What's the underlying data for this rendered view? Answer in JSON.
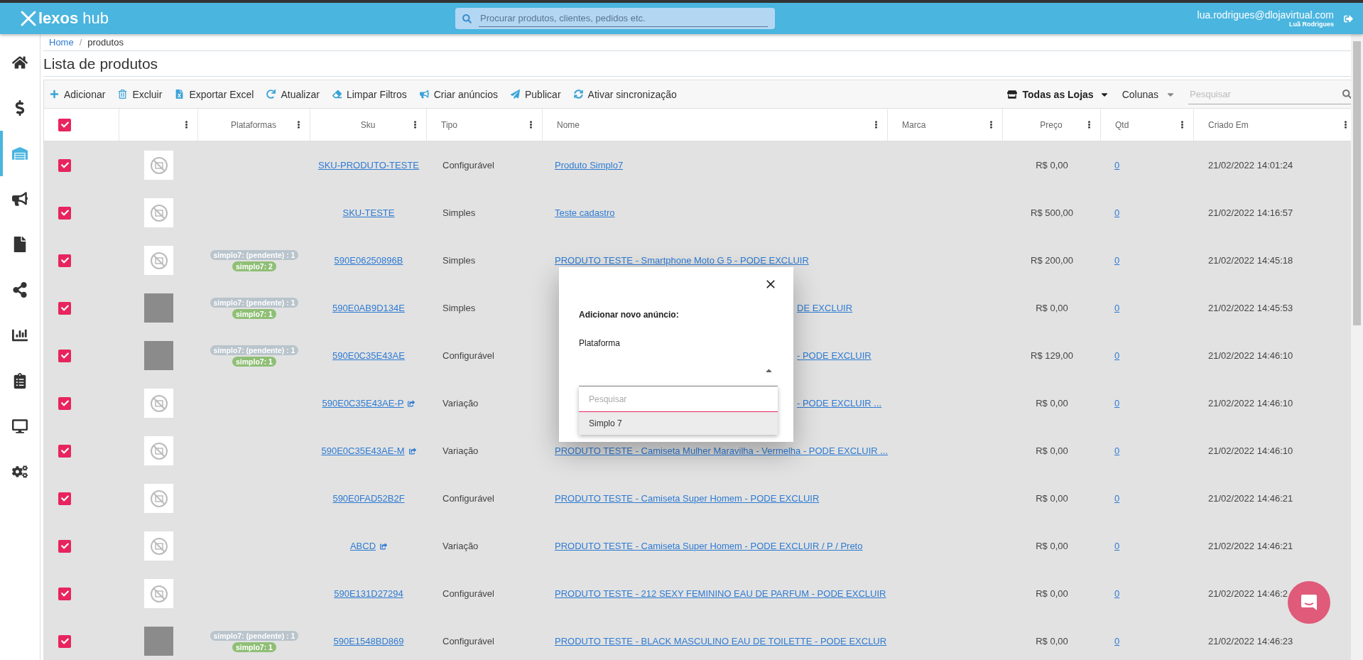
{
  "topbar": {
    "logo": {
      "brand": "lexos",
      "suffix": "hub"
    },
    "search": {
      "placeholder": "Procurar produtos, clientes, pedidos etc."
    },
    "user": {
      "email": "lua.rodrigues@dlojavirtual.com",
      "name": "Luã Rodrigues"
    }
  },
  "sidebar": {
    "items": [
      {
        "selected": false
      },
      {
        "selected": false
      },
      {
        "selected": true
      },
      {
        "selected": false
      },
      {
        "selected": false
      },
      {
        "selected": false
      },
      {
        "selected": false
      },
      {
        "selected": false
      },
      {
        "selected": false
      },
      {
        "selected": false
      }
    ]
  },
  "breadcrumb": {
    "separator": "/",
    "items": [
      {
        "label": "Home",
        "kind": "link"
      },
      {
        "label": "produtos",
        "kind": "current"
      }
    ]
  },
  "title": "Lista de produtos",
  "toolbar": {
    "actions": [
      "Adicionar",
      "Excluir",
      "Exportar Excel",
      "Atualizar",
      "Limpar Filtros",
      "Criar anúncios",
      "Publicar",
      "Ativar sincronização"
    ],
    "store_filter": "Todas as Lojas",
    "columns_menu": "Colunas",
    "search": {
      "placeholder": "Pesquisar"
    }
  },
  "table": {
    "all_checked": true,
    "columns": [
      {
        "kind": "image"
      },
      {
        "kind": "text",
        "label": "Plataformas"
      },
      {
        "kind": "text",
        "label": "Sku"
      },
      {
        "kind": "text",
        "label": "Tipo"
      },
      {
        "kind": "text",
        "label": "Nome"
      },
      {
        "kind": "text",
        "label": "Marca"
      },
      {
        "kind": "text",
        "label": "Preço"
      },
      {
        "kind": "text",
        "label": "Qtd"
      },
      {
        "kind": "text",
        "label": "Criado Em"
      }
    ],
    "rows": [
      {
        "checked": true,
        "image": {
          "kind": "placeholder"
        },
        "badges": [],
        "sku": "SKU-PRODUTO-TESTE",
        "sku_link_icon": false,
        "tipo": "Configurável",
        "nome": "Produto Simplo7",
        "covered": false,
        "preco": "R$ 0,00",
        "qtd": "0",
        "criado": "21/02/2022 14:01:24"
      },
      {
        "checked": true,
        "image": {
          "kind": "placeholder"
        },
        "badges": [],
        "sku": "SKU-TESTE",
        "sku_link_icon": false,
        "tipo": "Simples",
        "nome": "Teste cadastro",
        "covered": false,
        "preco": "R$ 500,00",
        "qtd": "0",
        "criado": "21/02/2022 14:16:57"
      },
      {
        "checked": true,
        "image": {
          "kind": "placeholder"
        },
        "badges": [
          {
            "kind": "pending",
            "label": "simplo7: (pendente) : 1"
          },
          {
            "kind": "synced",
            "label": "simplo7: 2"
          }
        ],
        "sku": "590E06250896B",
        "sku_link_icon": false,
        "tipo": "Simples",
        "nome": "PRODUTO TESTE - Smartphone Moto G 5 - PODE EXCLUIR",
        "covered": false,
        "preco": "R$ 200,00",
        "qtd": "0",
        "criado": "21/02/2022 14:45:18"
      },
      {
        "checked": true,
        "image": {
          "kind": "photo"
        },
        "badges": [
          {
            "kind": "pending",
            "label": "simplo7: (pendente) : 1"
          },
          {
            "kind": "synced",
            "label": "simplo7: 1"
          }
        ],
        "sku": "590E0AB9D134E",
        "sku_link_icon": false,
        "tipo": "Simples",
        "nome": "DE EXCLUIR",
        "covered": true,
        "preco": "R$ 0,00",
        "qtd": "0",
        "criado": "21/02/2022 14:45:53"
      },
      {
        "checked": true,
        "image": {
          "kind": "photo"
        },
        "badges": [
          {
            "kind": "pending",
            "label": "simplo7: (pendente) : 1"
          },
          {
            "kind": "synced",
            "label": "simplo7: 1"
          }
        ],
        "sku": "590E0C35E43AE",
        "sku_link_icon": false,
        "tipo": "Configurável",
        "nome": "- PODE EXCLUIR",
        "covered": true,
        "preco": "R$ 129,00",
        "qtd": "0",
        "criado": "21/02/2022 14:46:10"
      },
      {
        "checked": true,
        "image": {
          "kind": "placeholder"
        },
        "badges": [],
        "sku": "590E0C35E43AE-P",
        "sku_link_icon": true,
        "tipo": "Variação",
        "nome": "- PODE EXCLUIR ...",
        "covered": true,
        "preco": "R$ 0,00",
        "qtd": "0",
        "criado": "21/02/2022 14:46:10"
      },
      {
        "checked": true,
        "image": {
          "kind": "placeholder"
        },
        "badges": [],
        "sku": "590E0C35E43AE-M",
        "sku_link_icon": true,
        "tipo": "Variação",
        "nome": "PRODUTO TESTE - Camiseta Mulher Maravilha - Vermelha - PODE EXCLUIR ...",
        "covered": false,
        "preco": "R$ 0,00",
        "qtd": "0",
        "criado": "21/02/2022 14:46:10"
      },
      {
        "checked": true,
        "image": {
          "kind": "placeholder"
        },
        "badges": [],
        "sku": "590E0FAD52B2F",
        "sku_link_icon": false,
        "tipo": "Configurável",
        "nome": "PRODUTO TESTE - Camiseta Super Homem - PODE EXCLUIR",
        "covered": false,
        "preco": "R$ 0,00",
        "qtd": "0",
        "criado": "21/02/2022 14:46:21"
      },
      {
        "checked": true,
        "image": {
          "kind": "placeholder"
        },
        "badges": [],
        "sku": "ABCD",
        "sku_link_icon": true,
        "tipo": "Variação",
        "nome": "PRODUTO TESTE - Camiseta Super Homem - PODE EXCLUIR / P / Preto",
        "covered": false,
        "preco": "R$ 0,00",
        "qtd": "0",
        "criado": "21/02/2022 14:46:21"
      },
      {
        "checked": true,
        "image": {
          "kind": "placeholder"
        },
        "badges": [],
        "sku": "590E131D27294",
        "sku_link_icon": false,
        "tipo": "Configurável",
        "nome": "PRODUTO TESTE - 212 SEXY FEMININO EAU DE PARFUM - PODE EXCLUIR",
        "covered": false,
        "preco": "R$ 0,00",
        "qtd": "0",
        "criado": "21/02/2022 14:46:2"
      },
      {
        "checked": true,
        "image": {
          "kind": "photo"
        },
        "badges": [
          {
            "kind": "pending",
            "label": "simplo7: (pendente) : 1"
          },
          {
            "kind": "synced",
            "label": "simplo7: 1"
          }
        ],
        "sku": "590E1548BD869",
        "sku_link_icon": false,
        "tipo": "Configurável",
        "nome": "PRODUTO TESTE - BLACK MASCULINO EAU DE TOILETTE - PODE EXCLUR",
        "covered": false,
        "preco": "R$ 0,00",
        "qtd": "0",
        "criado": "21/02/2022 14:46:23"
      }
    ]
  },
  "modal": {
    "title": "Adicionar novo anúncio:",
    "field_label": "Plataforma",
    "select": {
      "expanded": true
    },
    "dropdown": {
      "search_placeholder": "Pesquisar",
      "options": [
        {
          "label": "Simplo 7",
          "selected": true
        }
      ]
    }
  }
}
